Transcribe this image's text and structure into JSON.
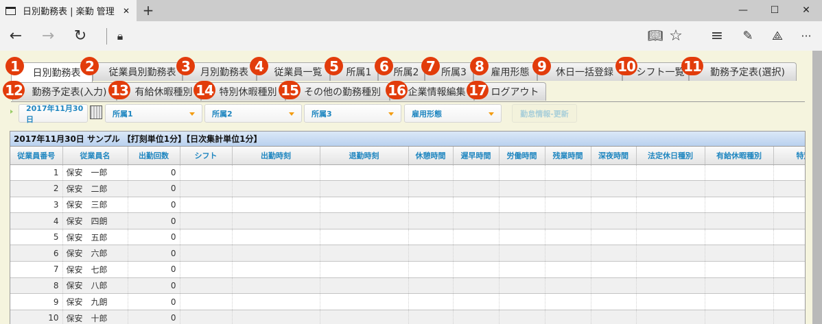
{
  "browser": {
    "tab_title": "日別勤務表 | 楽勤 管理",
    "new_tab": "+",
    "minimize": "—",
    "maximize": "☐",
    "close": "✕",
    "more": "···"
  },
  "nav_tabs_row1": [
    {
      "badge": "1",
      "label": "日別勤務表",
      "active": true
    },
    {
      "badge": "2",
      "label": "従業員別勤務表"
    },
    {
      "badge": "3",
      "label": "月別勤務表"
    },
    {
      "badge": "4",
      "label": "従業員一覧"
    },
    {
      "badge": "5",
      "label": "所属1"
    },
    {
      "badge": "6",
      "label": "所属2"
    },
    {
      "badge": "7",
      "label": "所属3"
    },
    {
      "badge": "8",
      "label": "雇用形態"
    },
    {
      "badge": "9",
      "label": "休日一括登録"
    },
    {
      "badge": "10",
      "label": "シフト一覧"
    },
    {
      "badge": "11",
      "label": "勤務予定表(選択)"
    }
  ],
  "nav_tabs_row2": [
    {
      "badge": "12",
      "label": "勤務予定表(入力)"
    },
    {
      "badge": "13",
      "label": "有給休暇種別"
    },
    {
      "badge": "14",
      "label": "特別休暇種別"
    },
    {
      "badge": "15",
      "label": "その他の勤務種別"
    },
    {
      "badge": "16",
      "label": "企業情報編集"
    },
    {
      "badge": "17",
      "label": "ログアウト"
    }
  ],
  "filters": {
    "date": "2017年11月30日",
    "dept1": "所属1",
    "dept2": "所属2",
    "dept3": "所属3",
    "employment_type": "雇用形態",
    "update_button": "勤怠情報-更新"
  },
  "grid": {
    "title": "2017年11月30日 サンプル 【打刻単位1分】【日次集計単位1分】",
    "columns": [
      "従業員番号",
      "従業員名",
      "出勤回数",
      "シフト",
      "出勤時刻",
      "退勤時刻",
      "休憩時間",
      "遅早時間",
      "労働時間",
      "残業時間",
      "深夜時間",
      "法定休日種別",
      "有給休暇種別",
      "特別休"
    ],
    "rows": [
      [
        "1",
        "保安　一郎",
        "0"
      ],
      [
        "2",
        "保安　二郎",
        "0"
      ],
      [
        "3",
        "保安　三郎",
        "0"
      ],
      [
        "4",
        "保安　四朗",
        "0"
      ],
      [
        "5",
        "保安　五郎",
        "0"
      ],
      [
        "6",
        "保安　六郎",
        "0"
      ],
      [
        "7",
        "保安　七郎",
        "0"
      ],
      [
        "8",
        "保安　八郎",
        "0"
      ],
      [
        "9",
        "保安　九朗",
        "0"
      ],
      [
        "10",
        "保安　十郎",
        "0"
      ]
    ]
  },
  "colors": {
    "badge": "#e23c0b",
    "header_text": "#1f86c0",
    "page_bg": "#f5f4de"
  }
}
